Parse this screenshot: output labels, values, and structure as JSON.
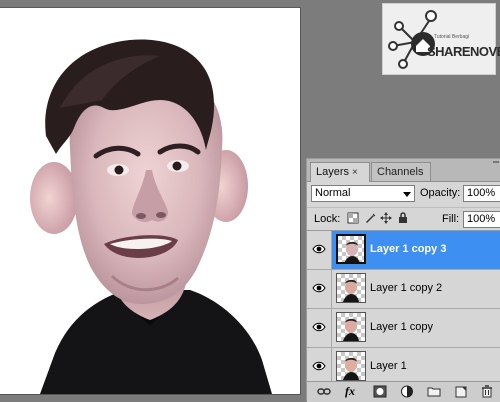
{
  "watermark": {
    "text": "SHARENOVEL",
    "subtext": "Tutorial Berbagi"
  },
  "layers_panel": {
    "tabs": [
      {
        "label": "Layers",
        "active": true
      },
      {
        "label": "Channels",
        "active": false
      }
    ],
    "close_glyph": "×",
    "blend_mode": "Normal",
    "opacity_label": "Opacity:",
    "opacity_value": "100%",
    "lock_label": "Lock:",
    "lock_icons": [
      "lock-transparent-icon",
      "lock-image-icon",
      "lock-position-icon",
      "lock-all-icon"
    ],
    "fill_label": "Fill:",
    "fill_value": "100%",
    "layers": [
      {
        "name": "Layer 1 copy 3",
        "visible": true,
        "selected": true
      },
      {
        "name": "Layer 1 copy 2",
        "visible": true,
        "selected": false
      },
      {
        "name": "Layer 1 copy",
        "visible": true,
        "selected": false
      },
      {
        "name": "Layer 1",
        "visible": true,
        "selected": false
      }
    ],
    "footer_icons": [
      "link-layers-icon",
      "fx-icon",
      "add-mask-icon",
      "adjustment-layer-icon",
      "new-group-icon",
      "new-layer-icon",
      "delete-layer-icon"
    ],
    "fx_label": "fx"
  },
  "colors": {
    "selection": "#3d8ff2",
    "panel_bg": "#d6d6d6",
    "workspace_bg": "#7c7c7c"
  }
}
